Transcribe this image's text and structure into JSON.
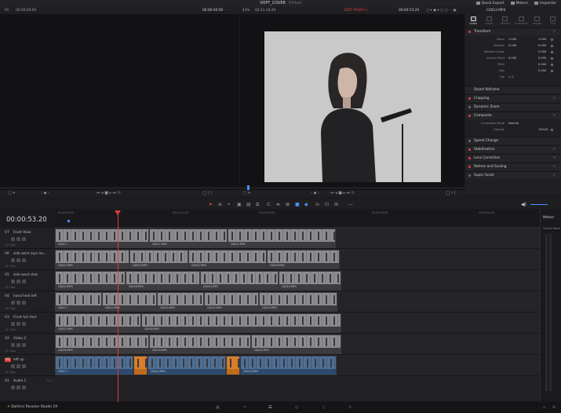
{
  "app": {
    "project_title": "VOFF_COVER",
    "project_status": "Edited",
    "topbar_right": [
      "Quick Export",
      "Meters",
      "Inspector"
    ]
  },
  "viewers": {
    "source_left": "Fit",
    "source_timecode": "00:00:00:00",
    "source_tc_right": "00:00:00:00",
    "zoom": "43%",
    "program_timecode": "00:11:34:20",
    "status": "EDIT PROXY ▾",
    "program_tc_right": "00:00:53:20",
    "clip_name": "C0012.MP4"
  },
  "inspector": {
    "tabs": [
      "Video",
      "Audio",
      "Effects",
      "Transition",
      "Image",
      "File"
    ],
    "sections": [
      "Transform",
      "Smart Reframe",
      "Cropping",
      "Dynamic Zoom",
      "Composite",
      "Speed Change",
      "Stabilization",
      "Lens Correction",
      "Retime and Scaling",
      "Super Scale"
    ],
    "transform": {
      "zoom_label": "Zoom",
      "zoom_x": "1.000",
      "zoom_y": "1.000",
      "position_label": "Position",
      "position_x": "0.000",
      "position_y": "0.000",
      "rotation_label": "Rotation Angle",
      "rotation": "0.000",
      "anchor_label": "Anchor Point",
      "anchor_x": "0.000",
      "anchor_y": "0.000",
      "pitch_label": "Pitch",
      "pitch": "0.000",
      "yaw_label": "Yaw",
      "yaw": "0.000",
      "flip_label": "Flip"
    },
    "composite": {
      "mode_label": "Composite Mode",
      "mode": "Normal",
      "opacity_label": "Opacity",
      "opacity": "100.00"
    }
  },
  "timeline": {
    "timecode": "00:00:53.20",
    "ruler_labels": [
      "00:00:00:00",
      "00:00:14:16",
      "00:00:29:08",
      "00:00:44:00",
      "00:00:58:16",
      "00:01:13:08"
    ],
    "tracks": [
      {
        "id": "V7",
        "name": "Front View",
        "count": "11 Clips"
      },
      {
        "id": "V6",
        "name": "side west (eye lev...",
        "count": "16 Clips"
      },
      {
        "id": "V5",
        "name": "side west shot",
        "count": "11 Clips"
      },
      {
        "id": "V4",
        "name": "hand held left",
        "count": "18 Clips"
      },
      {
        "id": "V3",
        "name": "Front full shot",
        "count": "11 Clips"
      },
      {
        "id": "V2",
        "name": "Video 2",
        "count": "11 Clips"
      },
      {
        "id": "V1",
        "name": "left up",
        "count": "16 Clips"
      },
      {
        "id": "A1",
        "name": "Audio 1",
        "count": "2.0"
      }
    ],
    "clip_labels": [
      "C0017...",
      "C0012.MP4",
      "C0014.MP4",
      "C0024.MP4",
      "C0022.MP4",
      "C0026.MP4",
      "C0012.MP4",
      "C0016.MP4",
      "C0023.MP4",
      "C0019.MP4"
    ]
  },
  "meters": {
    "title": "Meters",
    "subtitle": "Control Room"
  },
  "status": {
    "app_name": "DaVinci Resolve Studio 19"
  },
  "colors": {
    "accent": "#4a8fff",
    "playhead": "#e03a3a",
    "record": "#e04040",
    "audio_clip": "#4f6f94",
    "highlight_clip": "#d77d2c"
  }
}
